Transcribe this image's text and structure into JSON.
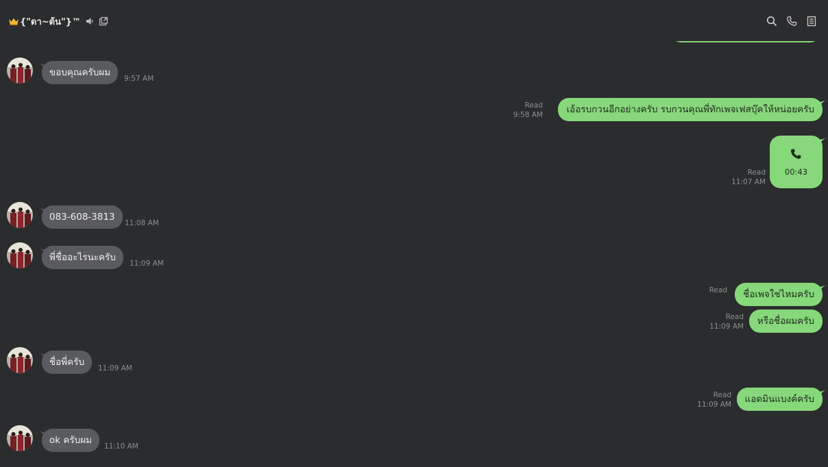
{
  "header": {
    "title": "{\"ดา~ต้น\"}™",
    "icons": [
      "crown-icon",
      "mute-icon",
      "external-window-icon"
    ],
    "actions": [
      "search-icon",
      "phone-icon",
      "notes-icon"
    ]
  },
  "colors": {
    "background": "#2b2c2e",
    "incoming_bubble": "#5a5b5e",
    "outgoing_bubble": "#86d87a",
    "meta_text": "#8e8f91"
  },
  "messages": [
    {
      "dir": "in",
      "text": "ขอบคุณครับผม",
      "time": "9:57 AM"
    },
    {
      "dir": "out",
      "text": "เอ้อรบกวนอีกอย่างครับ รบกวนคุณพี่ทักเพจเฟสบุ๊คให้หน่อยครับ",
      "read": "Read",
      "time": "9:58 AM"
    },
    {
      "dir": "out",
      "type": "call",
      "duration": "00:43",
      "read": "Read",
      "time": "11:07 AM"
    },
    {
      "dir": "in",
      "text": "083-608-3813",
      "time": "11:08 AM"
    },
    {
      "dir": "in",
      "text": "พี่ชื่ออะไรนะครับ",
      "time": "11:09 AM"
    },
    {
      "dir": "out",
      "text": "ชื่อเพจใช่ไหมครับ",
      "read": "Read"
    },
    {
      "dir": "out",
      "text": "หรือชื่อผมครับ",
      "read": "Read",
      "time": "11:09 AM"
    },
    {
      "dir": "in",
      "text": "ชื่อพี่ครับ",
      "time": "11:09 AM"
    },
    {
      "dir": "out",
      "text": "แอดมินแบงค์ครับ",
      "read": "Read",
      "time": "11:09 AM"
    },
    {
      "dir": "in",
      "text": "ok ครับผม",
      "time": "11:10 AM"
    }
  ]
}
